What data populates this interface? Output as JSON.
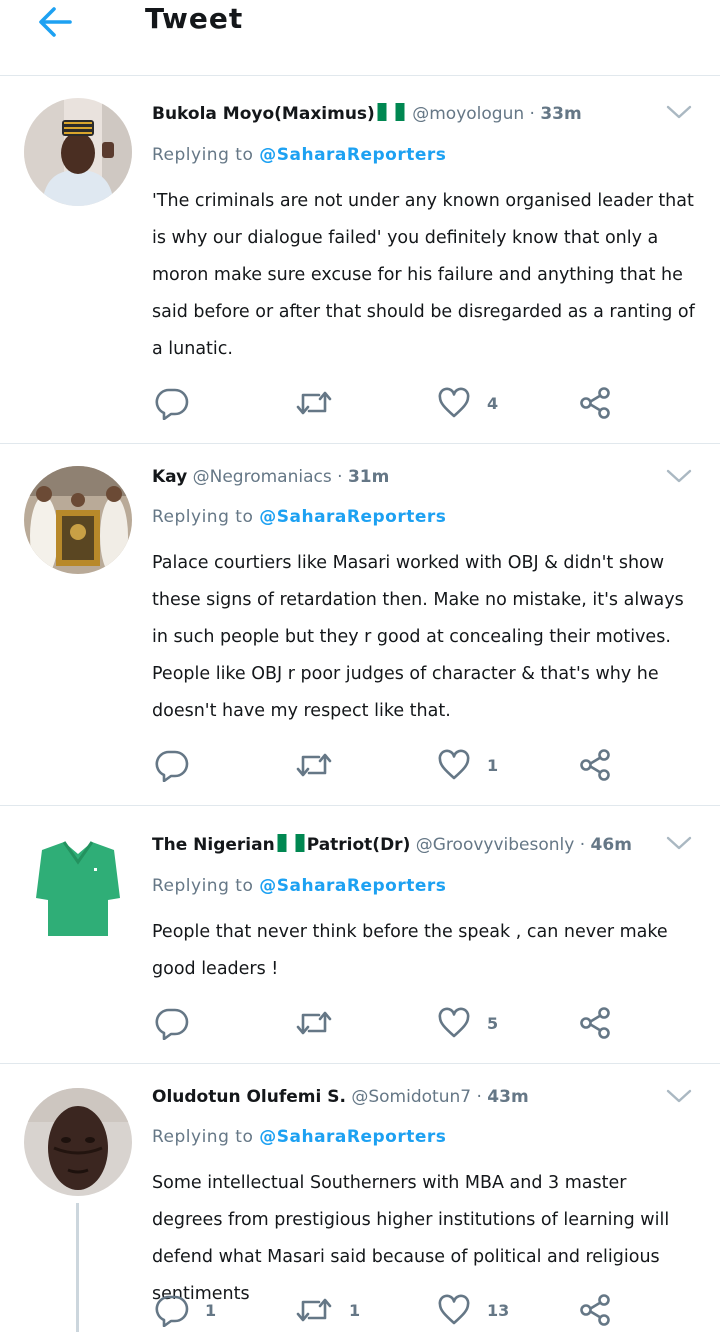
{
  "header": {
    "title": "Tweet"
  },
  "colors": {
    "accent": "#1da1f2",
    "muted": "#657786",
    "divider": "#e1e8ed",
    "text": "#14171a"
  },
  "icons": {
    "back": "arrow-left-icon",
    "more": "chevron-down-icon",
    "reply": "reply-icon",
    "retweet": "retweet-icon",
    "like": "heart-icon",
    "share": "share-icon",
    "flag": "nigeria-flag-icon"
  },
  "tweets": [
    {
      "name": "Bukola Moyo(Maximus)",
      "handle": "@moyologun",
      "sep": "·",
      "time": "33m",
      "reply_label": "Replying to",
      "reply_to": "@SaharaReporters",
      "text": "'The criminals are not under any known organised leader that is why our dialogue failed' you definitely know that only a moron make sure excuse for his failure and anything that he said before or after that should be disregarded as a ranting of a lunatic.",
      "replies": "",
      "retweets": "",
      "likes": "4"
    },
    {
      "name": "Kay",
      "handle": "@Negromaniacs",
      "sep": "·",
      "time": "31m",
      "reply_label": "Replying to",
      "reply_to": "@SaharaReporters",
      "text": "Palace courtiers like Masari worked with OBJ & didn't show these signs of retardation then. Make no mistake, it's always in such people but they r good at concealing their motives. People like OBJ r poor judges of character & that's why he doesn't have my respect like that.",
      "replies": "",
      "retweets": "",
      "likes": "1"
    },
    {
      "name_part1": "The Nigerian",
      "name_part2": "Patriot(Dr)",
      "handle": "@Groovyvibesonly",
      "sep": "·",
      "time": "46m",
      "reply_label": "Replying to",
      "reply_to": "@SaharaReporters",
      "text": "People that never think before the speak , can never make good leaders !",
      "replies": "",
      "retweets": "",
      "likes": "5"
    },
    {
      "name": "Oludotun Olufemi S.",
      "handle": "@Somidotun7",
      "sep": "·",
      "time": "43m",
      "reply_label": "Replying to",
      "reply_to": "@SaharaReporters",
      "text": "Some intellectual Southerners with MBA and 3 master degrees from prestigious higher institutions of learning will defend what Masari said because of political and religious sentiments",
      "replies": "1",
      "retweets": "1",
      "likes": "13"
    }
  ]
}
